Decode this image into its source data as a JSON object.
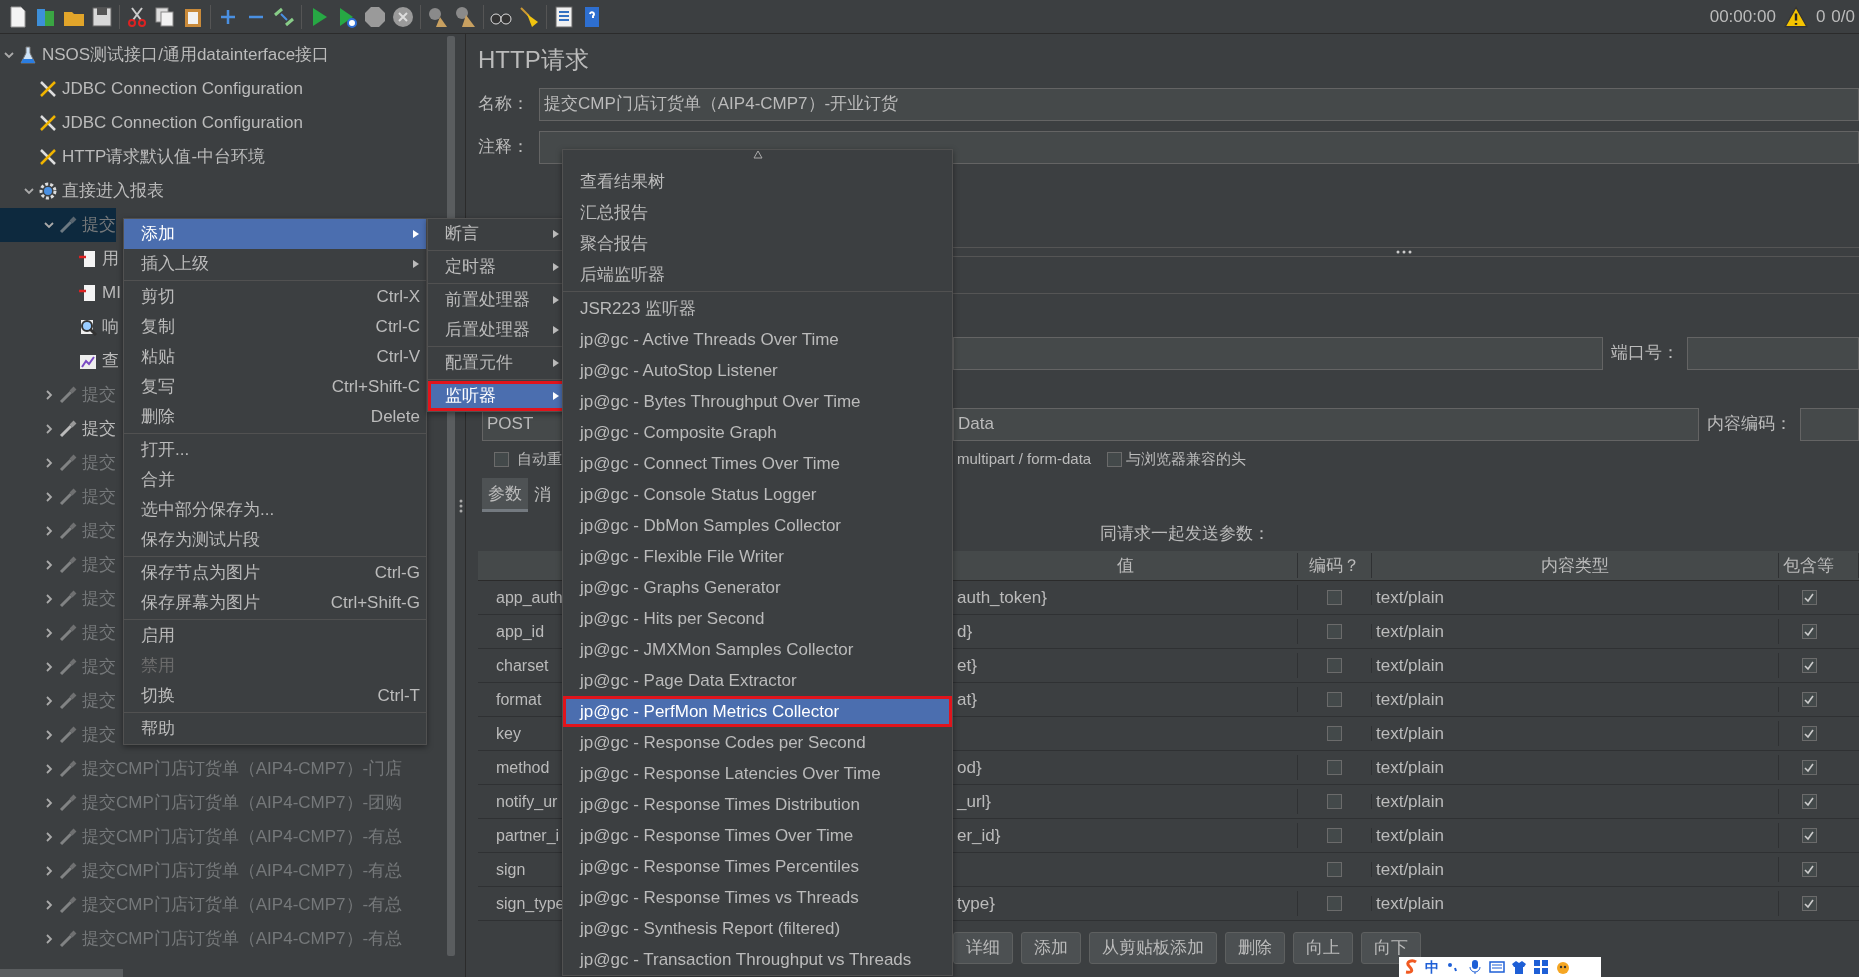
{
  "toolbar": {
    "timer": "00:00:00",
    "warnings": "0",
    "threads": "0/0"
  },
  "tree": {
    "items": [
      {
        "label": "NSOS测试接口/通用datainterface接口",
        "kind": "testplan",
        "expanded": true,
        "disabled": false,
        "selected": false,
        "children": [
          {
            "label": "JDBC Connection Configuration",
            "kind": "config",
            "disabled": false,
            "selected": false
          },
          {
            "label": "JDBC Connection Configuration",
            "kind": "config",
            "disabled": false,
            "selected": false
          },
          {
            "label": "HTTP请求默认值-中台环境",
            "kind": "config",
            "disabled": false,
            "selected": false
          },
          {
            "label": "直接进入报表",
            "kind": "threadgroup",
            "expanded": true,
            "disabled": false,
            "selected": false,
            "children": [
              {
                "label": "提交",
                "kind": "sampler",
                "expanded": true,
                "disabled": true,
                "selected": true,
                "children": [
                  {
                    "label": "用",
                    "kind": "preprocessor",
                    "disabled": false,
                    "selected": false
                  },
                  {
                    "label": "MI",
                    "kind": "preprocessor",
                    "disabled": false,
                    "selected": false
                  },
                  {
                    "label": "响",
                    "kind": "assertion",
                    "disabled": false,
                    "selected": false
                  },
                  {
                    "label": "查",
                    "kind": "listener",
                    "disabled": false,
                    "selected": false
                  }
                ]
              },
              {
                "label": "提交",
                "kind": "sampler",
                "expanded": false,
                "disabled": true,
                "selected": false
              },
              {
                "label": "提交",
                "kind": "sampler",
                "expanded": false,
                "disabled": false,
                "selected": false
              },
              {
                "label": "提交",
                "kind": "sampler",
                "expanded": false,
                "disabled": true,
                "selected": false
              },
              {
                "label": "提交",
                "kind": "sampler",
                "expanded": false,
                "disabled": true,
                "selected": false
              },
              {
                "label": "提交",
                "kind": "sampler",
                "expanded": false,
                "disabled": true,
                "selected": false
              },
              {
                "label": "提交",
                "kind": "sampler",
                "expanded": false,
                "disabled": true,
                "selected": false
              },
              {
                "label": "提交",
                "kind": "sampler",
                "expanded": false,
                "disabled": true,
                "selected": false
              },
              {
                "label": "提交",
                "kind": "sampler",
                "expanded": false,
                "disabled": true,
                "selected": false
              },
              {
                "label": "提交",
                "kind": "sampler",
                "expanded": false,
                "disabled": true,
                "selected": false
              },
              {
                "label": "提交",
                "kind": "sampler",
                "expanded": false,
                "disabled": true,
                "selected": false
              },
              {
                "label": "提交",
                "kind": "sampler",
                "expanded": false,
                "disabled": true,
                "selected": false
              },
              {
                "label": "提交CMP门店订货单（AIP4-CMP7）-门店",
                "kind": "sampler",
                "expanded": false,
                "disabled": true,
                "selected": false
              },
              {
                "label": "提交CMP门店订货单（AIP4-CMP7）-团购",
                "kind": "sampler",
                "expanded": false,
                "disabled": true,
                "selected": false
              },
              {
                "label": "提交CMP门店订货单（AIP4-CMP7）-有总",
                "kind": "sampler",
                "expanded": false,
                "disabled": true,
                "selected": false
              },
              {
                "label": "提交CMP门店订货单（AIP4-CMP7）-有总",
                "kind": "sampler",
                "expanded": false,
                "disabled": true,
                "selected": false
              },
              {
                "label": "提交CMP门店订货单（AIP4-CMP7）-有总",
                "kind": "sampler",
                "expanded": false,
                "disabled": true,
                "selected": false
              },
              {
                "label": "提交CMP门店订货单（AIP4-CMP7）-有总",
                "kind": "sampler",
                "expanded": false,
                "disabled": true,
                "selected": false
              }
            ]
          }
        ]
      }
    ]
  },
  "editor": {
    "title": "HTTP请求",
    "name_label": "名称：",
    "name_value": "提交CMP门店订货单（AIP4-CMP7）-开业订货",
    "comment_label": "注释：",
    "port_label": "端口号：",
    "method_value": "POST",
    "path_value": "Data",
    "encoding_label": "内容编码：",
    "redirect_option": {
      "label": "自动重",
      "checked": false
    },
    "multipart_label": "multipart / form-data",
    "browser_headers_option": {
      "label": "与浏览器兼容的头",
      "checked": false
    },
    "tabs": [
      {
        "label": "参数",
        "selected": true
      },
      {
        "label": "消",
        "selected": false
      }
    ],
    "params_title": "同请求一起发送参数：",
    "table": {
      "columns": [
        "值",
        "编码？",
        "内容类型",
        "包含等"
      ],
      "rows": [
        {
          "name": "app_auth",
          "value": "auth_token}",
          "encode": false,
          "content_type": "text/plain",
          "include_equals": true
        },
        {
          "name": "app_id",
          "value": "d}",
          "encode": false,
          "content_type": "text/plain",
          "include_equals": true
        },
        {
          "name": "charset",
          "value": "et}",
          "encode": false,
          "content_type": "text/plain",
          "include_equals": true
        },
        {
          "name": "format",
          "value": "at}",
          "encode": false,
          "content_type": "text/plain",
          "include_equals": true
        },
        {
          "name": "key",
          "encode": false,
          "content_type": "text/plain",
          "include_equals": true
        },
        {
          "name": "method",
          "value": "od}",
          "encode": false,
          "content_type": "text/plain",
          "include_equals": true
        },
        {
          "name": "notify_ur",
          "value": "_url}",
          "encode": false,
          "content_type": "text/plain",
          "include_equals": true
        },
        {
          "name": "partner_i",
          "value": "er_id}",
          "encode": false,
          "content_type": "text/plain",
          "include_equals": true
        },
        {
          "name": "sign",
          "encode": false,
          "content_type": "text/plain",
          "include_equals": true
        },
        {
          "name": "sign_type",
          "value": "type}",
          "encode": false,
          "content_type": "text/plain",
          "include_equals": true
        }
      ]
    },
    "buttons": [
      "详细",
      "添加",
      "从剪贴板添加",
      "删除",
      "向上",
      "向下"
    ]
  },
  "context_menu": {
    "groups": [
      [
        {
          "label": "添加",
          "kind": "submenu",
          "selected": true,
          "disabled": false
        },
        {
          "label": "插入上级",
          "kind": "submenu",
          "selected": false,
          "disabled": false
        }
      ],
      [
        {
          "label": "剪切",
          "shortcut": "Ctrl-X",
          "kind": "item",
          "selected": false,
          "disabled": false
        },
        {
          "label": "复制",
          "shortcut": "Ctrl-C",
          "kind": "item",
          "selected": false,
          "disabled": false
        },
        {
          "label": "粘贴",
          "shortcut": "Ctrl-V",
          "kind": "item",
          "selected": false,
          "disabled": false
        },
        {
          "label": "复写",
          "shortcut": "Ctrl+Shift-C",
          "kind": "item",
          "selected": false,
          "disabled": false
        },
        {
          "label": "删除",
          "shortcut": "Delete",
          "kind": "item",
          "selected": false,
          "disabled": false
        }
      ],
      [
        {
          "label": "打开...",
          "kind": "item",
          "selected": false,
          "disabled": false
        },
        {
          "label": "合并",
          "kind": "item",
          "selected": false,
          "disabled": false
        },
        {
          "label": "选中部分保存为...",
          "kind": "item",
          "selected": false,
          "disabled": false
        },
        {
          "label": "保存为测试片段",
          "kind": "item",
          "selected": false,
          "disabled": false
        }
      ],
      [
        {
          "label": "保存节点为图片",
          "shortcut": "Ctrl-G",
          "kind": "item",
          "selected": false,
          "disabled": false
        },
        {
          "label": "保存屏幕为图片",
          "shortcut": "Ctrl+Shift-G",
          "kind": "item",
          "selected": false,
          "disabled": false
        }
      ],
      [
        {
          "label": "启用",
          "kind": "item",
          "selected": false,
          "disabled": false
        },
        {
          "label": "禁用",
          "kind": "item",
          "selected": false,
          "disabled": true
        },
        {
          "label": "切换",
          "shortcut": "Ctrl-T",
          "kind": "item",
          "selected": false,
          "disabled": false
        }
      ],
      [
        {
          "label": "帮助",
          "kind": "item",
          "selected": false,
          "disabled": false
        }
      ]
    ]
  },
  "add_submenu": {
    "groups": [
      [
        {
          "label": "断言",
          "selected": false
        }
      ],
      [
        {
          "label": "定时器",
          "selected": false
        }
      ],
      [
        {
          "label": "前置处理器",
          "selected": false
        },
        {
          "label": "后置处理器",
          "selected": false
        }
      ],
      [
        {
          "label": "配置元件",
          "selected": false
        }
      ],
      [
        {
          "label": "监听器",
          "selected": true
        }
      ]
    ]
  },
  "listener_menu": {
    "groups": [
      [
        {
          "label": "查看结果树",
          "selected": false
        },
        {
          "label": "汇总报告",
          "selected": false
        },
        {
          "label": "聚合报告",
          "selected": false
        },
        {
          "label": "后端监听器",
          "selected": false
        }
      ],
      [
        {
          "label": "JSR223 监听器",
          "selected": false
        },
        {
          "label": "jp@gc - Active Threads Over Time",
          "selected": false
        },
        {
          "label": "jp@gc - AutoStop Listener",
          "selected": false
        },
        {
          "label": "jp@gc - Bytes Throughput Over Time",
          "selected": false
        },
        {
          "label": "jp@gc - Composite Graph",
          "selected": false
        },
        {
          "label": "jp@gc - Connect Times Over Time",
          "selected": false
        },
        {
          "label": "jp@gc - Console Status Logger",
          "selected": false
        },
        {
          "label": "jp@gc - DbMon Samples Collector",
          "selected": false
        },
        {
          "label": "jp@gc - Flexible File Writer",
          "selected": false
        },
        {
          "label": "jp@gc - Graphs Generator",
          "selected": false
        },
        {
          "label": "jp@gc - Hits per Second",
          "selected": false
        },
        {
          "label": "jp@gc - JMXMon Samples Collector",
          "selected": false
        },
        {
          "label": "jp@gc - Page Data Extractor",
          "selected": false
        },
        {
          "label": "jp@gc - PerfMon Metrics Collector",
          "selected": true
        },
        {
          "label": "jp@gc - Response Codes per Second",
          "selected": false
        },
        {
          "label": "jp@gc - Response Latencies Over Time",
          "selected": false
        },
        {
          "label": "jp@gc - Response Times Distribution",
          "selected": false
        },
        {
          "label": "jp@gc - Response Times Over Time",
          "selected": false
        },
        {
          "label": "jp@gc - Response Times Percentiles",
          "selected": false
        },
        {
          "label": "jp@gc - Response Times vs Threads",
          "selected": false
        },
        {
          "label": "jp@gc - Synthesis Report (filtered)",
          "selected": false
        },
        {
          "label": "jp@gc - Transaction Throughput vs Threads",
          "selected": false
        }
      ]
    ]
  },
  "ime_toolbar": {
    "mode": "中"
  }
}
